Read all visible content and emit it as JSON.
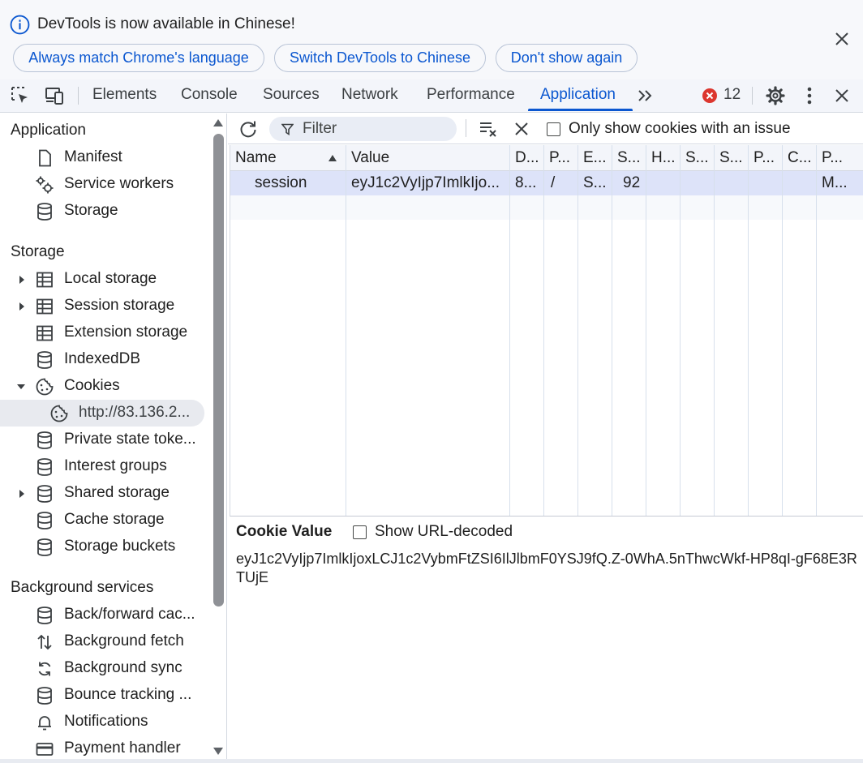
{
  "infobar": {
    "message": "DevTools is now available in Chinese!",
    "buttons": {
      "match": "Always match Chrome's language",
      "switch": "Switch DevTools to Chinese",
      "dont_show": "Don't show again"
    }
  },
  "toolbar": {
    "tabs": [
      "Elements",
      "Console",
      "Sources",
      "Network",
      "Performance",
      "Application"
    ],
    "active_tab": "Application",
    "error_count": "12"
  },
  "sidebar": {
    "sections": {
      "application": "Application",
      "storage": "Storage",
      "background": "Background services"
    },
    "application_items": [
      "Manifest",
      "Service workers",
      "Storage"
    ],
    "storage_items": [
      "Local storage",
      "Session storage",
      "Extension storage",
      "IndexedDB",
      "Cookies",
      "http://83.136.2...",
      "Private state toke...",
      "Interest groups",
      "Shared storage",
      "Cache storage",
      "Storage buckets"
    ],
    "background_items": [
      "Back/forward cac...",
      "Background fetch",
      "Background sync",
      "Bounce tracking ...",
      "Notifications",
      "Payment handler"
    ]
  },
  "cookies": {
    "filter_placeholder": "Filter",
    "only_issues_label": "Only show cookies with an issue",
    "columns": [
      "Name",
      "Value",
      "D...",
      "P...",
      "E...",
      "S...",
      "H...",
      "S...",
      "S...",
      "P...",
      "C...",
      "P..."
    ],
    "row": [
      "session",
      "eyJ1c2VyIjp7ImlkIjo...",
      "8...",
      "/",
      "S...",
      "92",
      "",
      "",
      "",
      "",
      "",
      "M..."
    ],
    "value_title": "Cookie Value",
    "show_decoded_label": "Show URL-decoded",
    "value_full": "eyJ1c2VyIjp7ImlkIjoxLCJ1c2VybmFtZSI6IlJlbmF0YSJ9fQ.Z-0WhA.5nThwcWkf-HP8qI-gF68E3RTUjE"
  },
  "colors": {
    "accent": "#0b57d0",
    "error": "#dc362e",
    "selected_row": "#dde3f9"
  }
}
